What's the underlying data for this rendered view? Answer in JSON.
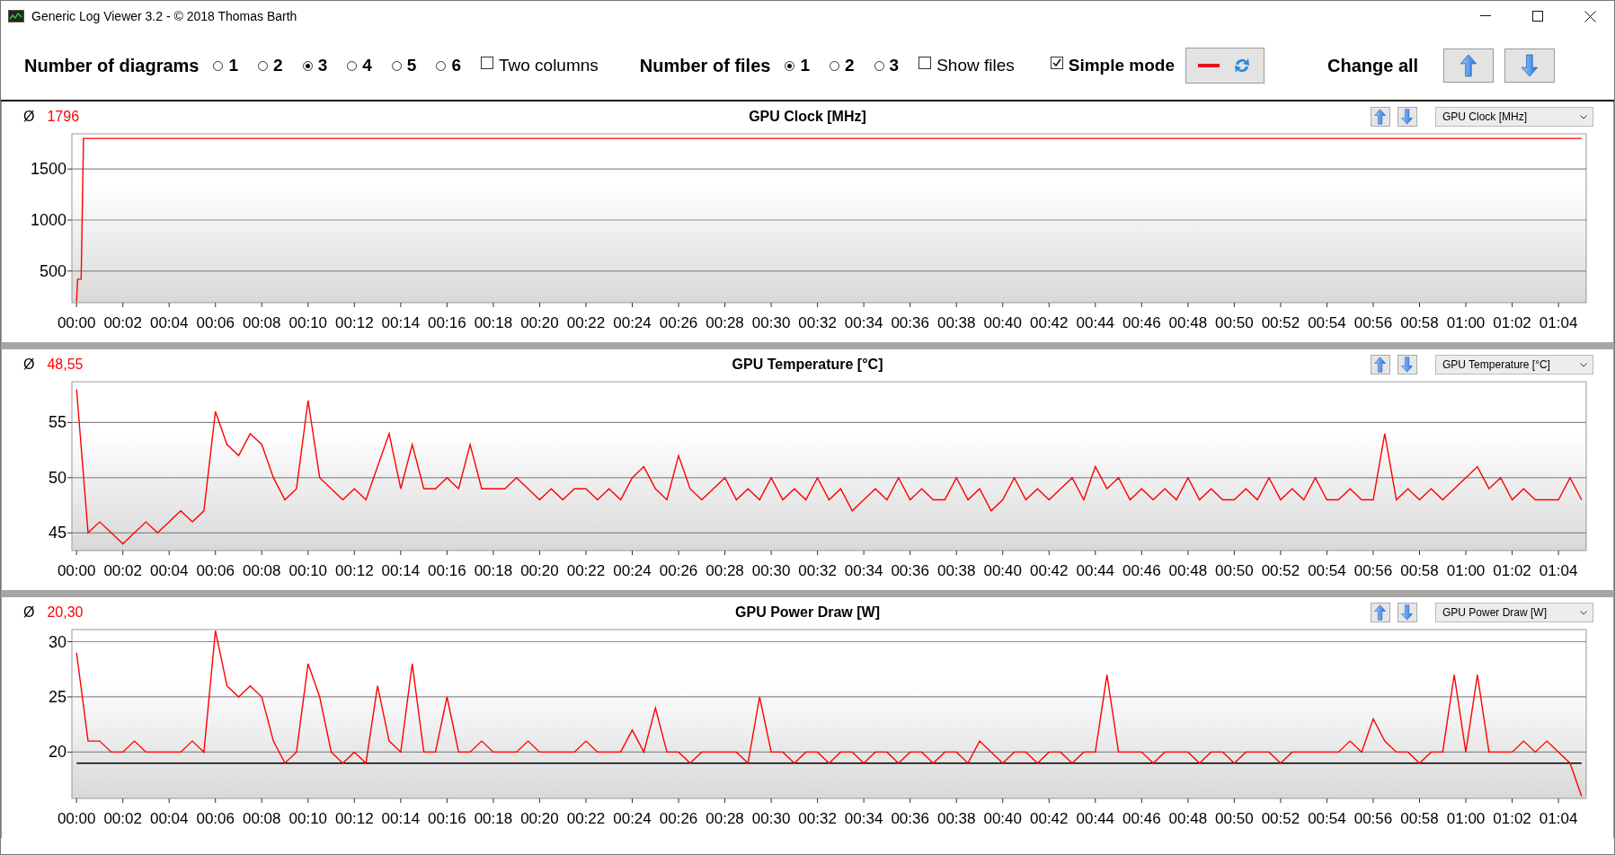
{
  "window": {
    "title": "Generic Log Viewer 3.2 - © 2018 Thomas Barth"
  },
  "toolbar": {
    "diagrams": {
      "label": "Number of diagrams",
      "options": [
        {
          "label": "1",
          "selected": false
        },
        {
          "label": "2",
          "selected": false
        },
        {
          "label": "3",
          "selected": true
        },
        {
          "label": "4",
          "selected": false
        },
        {
          "label": "5",
          "selected": false
        },
        {
          "label": "6",
          "selected": false
        }
      ]
    },
    "two_columns": {
      "label": "Two columns",
      "checked": false
    },
    "files": {
      "label": "Number of files",
      "options": [
        {
          "label": "1",
          "selected": true
        },
        {
          "label": "2",
          "selected": false
        },
        {
          "label": "3",
          "selected": false
        }
      ]
    },
    "show_files": {
      "label": "Show files",
      "checked": false
    },
    "simple_mode": {
      "label": "Simple mode",
      "checked": true
    },
    "change_all": {
      "label": "Change all"
    }
  },
  "diagrams": [
    {
      "average_symbol": "Ø",
      "average": "1796",
      "title": "GPU Clock [MHz]",
      "chart_data": {
        "type": "line",
        "x": [
          0,
          0.05,
          0.2,
          0.3,
          65
        ],
        "series": [
          {
            "name": "GPU Clock [MHz]",
            "color": "#ff0000",
            "values": [
              200,
              420,
              420,
              1800,
              1800
            ]
          }
        ],
        "grid": true,
        "xlim": [
          -0.2,
          65.2
        ],
        "ylim": [
          190,
          1845
        ],
        "yticks": [
          500,
          1000,
          1500
        ],
        "xticks": [
          {
            "value": 0,
            "label": "00:00"
          },
          {
            "value": 2,
            "label": "00:02"
          },
          {
            "value": 4,
            "label": "00:04"
          },
          {
            "value": 6,
            "label": "00:06"
          },
          {
            "value": 8,
            "label": "00:08"
          },
          {
            "value": 10,
            "label": "00:10"
          },
          {
            "value": 12,
            "label": "00:12"
          },
          {
            "value": 14,
            "label": "00:14"
          },
          {
            "value": 16,
            "label": "00:16"
          },
          {
            "value": 18,
            "label": "00:18"
          },
          {
            "value": 20,
            "label": "00:20"
          },
          {
            "value": 22,
            "label": "00:22"
          },
          {
            "value": 24,
            "label": "00:24"
          },
          {
            "value": 26,
            "label": "00:26"
          },
          {
            "value": 28,
            "label": "00:28"
          },
          {
            "value": 30,
            "label": "00:30"
          },
          {
            "value": 32,
            "label": "00:32"
          },
          {
            "value": 34,
            "label": "00:34"
          },
          {
            "value": 36,
            "label": "00:36"
          },
          {
            "value": 38,
            "label": "00:38"
          },
          {
            "value": 40,
            "label": "00:40"
          },
          {
            "value": 42,
            "label": "00:42"
          },
          {
            "value": 44,
            "label": "00:44"
          },
          {
            "value": 46,
            "label": "00:46"
          },
          {
            "value": 48,
            "label": "00:48"
          },
          {
            "value": 50,
            "label": "00:50"
          },
          {
            "value": 52,
            "label": "00:52"
          },
          {
            "value": 54,
            "label": "00:54"
          },
          {
            "value": 56,
            "label": "00:56"
          },
          {
            "value": 58,
            "label": "00:58"
          },
          {
            "value": 60,
            "label": "01:00"
          },
          {
            "value": 62,
            "label": "01:02"
          },
          {
            "value": 64,
            "label": "01:04"
          }
        ]
      }
    },
    {
      "average_symbol": "Ø",
      "average": "48,55",
      "title": "GPU Temperature [°C]",
      "chart_data": {
        "type": "line",
        "x": [
          0,
          0.5,
          1,
          1.5,
          2,
          2.5,
          3,
          3.5,
          4,
          4.5,
          5,
          5.5,
          6,
          6.5,
          7,
          7.5,
          8,
          8.5,
          9,
          9.5,
          10,
          10.5,
          11,
          11.5,
          12,
          12.5,
          13,
          13.5,
          14,
          14.5,
          15,
          15.5,
          16,
          16.5,
          17,
          17.5,
          18,
          18.5,
          19,
          19.5,
          20,
          20.5,
          21,
          21.5,
          22,
          22.5,
          23,
          23.5,
          24,
          24.5,
          25,
          25.5,
          26,
          26.5,
          27,
          27.5,
          28,
          28.5,
          29,
          29.5,
          30,
          30.5,
          31,
          31.5,
          32,
          32.5,
          33,
          33.5,
          34,
          34.5,
          35,
          35.5,
          36,
          36.5,
          37,
          37.5,
          38,
          38.5,
          39,
          39.5,
          40,
          40.5,
          41,
          41.5,
          42,
          42.5,
          43,
          43.5,
          44,
          44.5,
          45,
          45.5,
          46,
          46.5,
          47,
          47.5,
          48,
          48.5,
          49,
          49.5,
          50,
          50.5,
          51,
          51.5,
          52,
          52.5,
          53,
          53.5,
          54,
          54.5,
          55,
          55.5,
          56,
          56.5,
          57,
          57.5,
          58,
          58.5,
          59,
          59.5,
          60,
          60.5,
          61,
          61.5,
          62,
          62.5,
          63,
          63.5,
          64,
          64.5,
          65
        ],
        "grid": true,
        "series": [
          {
            "name": "GPU Temperature [°C]",
            "color": "#ff0000",
            "values": [
              58,
              45,
              46,
              45,
              44,
              45,
              46,
              45,
              46,
              47,
              46,
              47,
              56,
              53,
              52,
              54,
              53,
              50,
              48,
              49,
              57,
              50,
              49,
              48,
              49,
              48,
              51,
              54,
              49,
              53,
              49,
              49,
              50,
              49,
              53,
              49,
              49,
              49,
              50,
              49,
              48,
              49,
              48,
              49,
              49,
              48,
              49,
              48,
              50,
              51,
              49,
              48,
              52,
              49,
              48,
              49,
              50,
              48,
              49,
              48,
              50,
              48,
              49,
              48,
              50,
              48,
              49,
              47,
              48,
              49,
              48,
              50,
              48,
              49,
              48,
              48,
              50,
              48,
              49,
              47,
              48,
              50,
              48,
              49,
              48,
              49,
              50,
              48,
              51,
              49,
              50,
              48,
              49,
              48,
              49,
              48,
              50,
              48,
              49,
              48,
              48,
              49,
              48,
              50,
              48,
              49,
              48,
              50,
              48,
              48,
              49,
              48,
              48,
              54,
              48,
              49,
              48,
              49,
              48,
              49,
              50,
              51,
              49,
              50,
              48,
              49,
              48,
              48,
              48,
              50,
              48
            ]
          }
        ],
        "xlim": [
          -0.2,
          65.2
        ],
        "ylim": [
          43.4,
          58.7
        ],
        "yticks": [
          45,
          50,
          55
        ],
        "xticks": [
          {
            "value": 0,
            "label": "00:00"
          },
          {
            "value": 2,
            "label": "00:02"
          },
          {
            "value": 4,
            "label": "00:04"
          },
          {
            "value": 6,
            "label": "00:06"
          },
          {
            "value": 8,
            "label": "00:08"
          },
          {
            "value": 10,
            "label": "00:10"
          },
          {
            "value": 12,
            "label": "00:12"
          },
          {
            "value": 14,
            "label": "00:14"
          },
          {
            "value": 16,
            "label": "00:16"
          },
          {
            "value": 18,
            "label": "00:18"
          },
          {
            "value": 20,
            "label": "00:20"
          },
          {
            "value": 22,
            "label": "00:22"
          },
          {
            "value": 24,
            "label": "00:24"
          },
          {
            "value": 26,
            "label": "00:26"
          },
          {
            "value": 28,
            "label": "00:28"
          },
          {
            "value": 30,
            "label": "00:30"
          },
          {
            "value": 32,
            "label": "00:32"
          },
          {
            "value": 34,
            "label": "00:34"
          },
          {
            "value": 36,
            "label": "00:36"
          },
          {
            "value": 38,
            "label": "00:38"
          },
          {
            "value": 40,
            "label": "00:40"
          },
          {
            "value": 42,
            "label": "00:42"
          },
          {
            "value": 44,
            "label": "00:44"
          },
          {
            "value": 46,
            "label": "00:46"
          },
          {
            "value": 48,
            "label": "00:48"
          },
          {
            "value": 50,
            "label": "00:50"
          },
          {
            "value": 52,
            "label": "00:52"
          },
          {
            "value": 54,
            "label": "00:54"
          },
          {
            "value": 56,
            "label": "00:56"
          },
          {
            "value": 58,
            "label": "00:58"
          },
          {
            "value": 60,
            "label": "01:00"
          },
          {
            "value": 62,
            "label": "01:02"
          },
          {
            "value": 64,
            "label": "01:04"
          }
        ]
      }
    },
    {
      "average_symbol": "Ø",
      "average": "20,30",
      "title": "GPU Power Draw [W]",
      "chart_data": {
        "type": "line",
        "x": [
          0,
          0.5,
          1,
          1.5,
          2,
          2.5,
          3,
          3.5,
          4,
          4.5,
          5,
          5.5,
          6,
          6.5,
          7,
          7.5,
          8,
          8.5,
          9,
          9.5,
          10,
          10.5,
          11,
          11.5,
          12,
          12.5,
          13,
          13.5,
          14,
          14.5,
          15,
          15.5,
          16,
          16.5,
          17,
          17.5,
          18,
          18.5,
          19,
          19.5,
          20,
          20.5,
          21,
          21.5,
          22,
          22.5,
          23,
          23.5,
          24,
          24.5,
          25,
          25.5,
          26,
          26.5,
          27,
          27.5,
          28,
          28.5,
          29,
          29.5,
          30,
          30.5,
          31,
          31.5,
          32,
          32.5,
          33,
          33.5,
          34,
          34.5,
          35,
          35.5,
          36,
          36.5,
          37,
          37.5,
          38,
          38.5,
          39,
          39.5,
          40,
          40.5,
          41,
          41.5,
          42,
          42.5,
          43,
          43.5,
          44,
          44.5,
          45,
          45.5,
          46,
          46.5,
          47,
          47.5,
          48,
          48.5,
          49,
          49.5,
          50,
          50.5,
          51,
          51.5,
          52,
          52.5,
          53,
          53.5,
          54,
          54.5,
          55,
          55.5,
          56,
          56.5,
          57,
          57.5,
          58,
          58.5,
          59,
          59.5,
          60,
          60.5,
          61,
          61.5,
          62,
          62.5,
          63,
          63.5,
          64,
          64.5,
          65
        ],
        "series": [
          {
            "color": "#000000",
            "values": [
              19,
              19,
              19,
              19,
              19,
              19,
              19,
              19,
              19,
              19,
              19,
              19,
              19,
              19,
              19,
              19,
              19,
              19,
              19,
              19,
              19,
              19,
              19,
              19,
              19,
              19,
              19,
              19,
              19,
              19,
              19,
              19,
              19,
              19,
              19,
              19,
              19,
              19,
              19,
              19,
              19,
              19,
              19,
              19,
              19,
              19,
              19,
              19,
              19,
              19,
              19,
              19,
              19,
              19,
              19,
              19,
              19,
              19,
              19,
              19,
              19,
              19,
              19,
              19,
              19,
              19,
              19,
              19,
              19,
              19,
              19,
              19,
              19,
              19,
              19,
              19,
              19,
              19,
              19,
              19,
              19,
              19,
              19,
              19,
              19,
              19,
              19,
              19,
              19,
              19,
              19,
              19,
              19,
              19,
              19,
              19,
              19,
              19,
              19,
              19,
              19,
              19,
              19,
              19,
              19,
              19,
              19,
              19,
              19,
              19,
              19,
              19,
              19,
              19,
              19,
              19,
              19,
              19,
              19,
              19,
              19,
              19,
              19,
              19,
              19,
              19,
              19,
              19,
              19,
              19,
              19
            ]
          },
          {
            "name": "GPU Power Draw [W]",
            "color": "#ff0000",
            "values": [
              29,
              21,
              21,
              20,
              20,
              21,
              20,
              20,
              20,
              20,
              21,
              20,
              31,
              26,
              25,
              26,
              25,
              21,
              19,
              20,
              28,
              25,
              20,
              19,
              20,
              19,
              26,
              21,
              20,
              28,
              20,
              20,
              25,
              20,
              20,
              21,
              20,
              20,
              20,
              21,
              20,
              20,
              20,
              20,
              21,
              20,
              20,
              20,
              22,
              20,
              24,
              20,
              20,
              19,
              20,
              20,
              20,
              20,
              19,
              25,
              20,
              20,
              19,
              20,
              20,
              19,
              20,
              20,
              19,
              20,
              20,
              19,
              20,
              20,
              19,
              20,
              20,
              19,
              21,
              20,
              19,
              20,
              20,
              19,
              20,
              20,
              19,
              20,
              20,
              27,
              20,
              20,
              20,
              19,
              20,
              20,
              20,
              19,
              20,
              20,
              19,
              20,
              20,
              20,
              19,
              20,
              20,
              20,
              20,
              20,
              21,
              20,
              23,
              21,
              20,
              20,
              19,
              20,
              20,
              27,
              20,
              27,
              20,
              20,
              20,
              21,
              20,
              21,
              20,
              19,
              16
            ]
          }
        ],
        "grid": true,
        "xlim": [
          -0.2,
          65.2
        ],
        "ylim": [
          15.8,
          31.1
        ],
        "yticks": [
          20,
          25,
          30
        ],
        "xticks": [
          {
            "value": 0,
            "label": "00:00"
          },
          {
            "value": 2,
            "label": "00:02"
          },
          {
            "value": 4,
            "label": "00:04"
          },
          {
            "value": 6,
            "label": "00:06"
          },
          {
            "value": 8,
            "label": "00:08"
          },
          {
            "value": 10,
            "label": "00:10"
          },
          {
            "value": 12,
            "label": "00:12"
          },
          {
            "value": 14,
            "label": "00:14"
          },
          {
            "value": 16,
            "label": "00:16"
          },
          {
            "value": 18,
            "label": "00:18"
          },
          {
            "value": 20,
            "label": "00:20"
          },
          {
            "value": 22,
            "label": "00:22"
          },
          {
            "value": 24,
            "label": "00:24"
          },
          {
            "value": 26,
            "label": "00:26"
          },
          {
            "value": 28,
            "label": "00:28"
          },
          {
            "value": 30,
            "label": "00:30"
          },
          {
            "value": 32,
            "label": "00:32"
          },
          {
            "value": 34,
            "label": "00:34"
          },
          {
            "value": 36,
            "label": "00:36"
          },
          {
            "value": 38,
            "label": "00:38"
          },
          {
            "value": 40,
            "label": "00:40"
          },
          {
            "value": 42,
            "label": "00:42"
          },
          {
            "value": 44,
            "label": "00:44"
          },
          {
            "value": 46,
            "label": "00:46"
          },
          {
            "value": 48,
            "label": "00:48"
          },
          {
            "value": 50,
            "label": "00:50"
          },
          {
            "value": 52,
            "label": "00:52"
          },
          {
            "value": 54,
            "label": "00:54"
          },
          {
            "value": 56,
            "label": "00:56"
          },
          {
            "value": 58,
            "label": "00:58"
          },
          {
            "value": 60,
            "label": "01:00"
          },
          {
            "value": 62,
            "label": "01:02"
          },
          {
            "value": 64,
            "label": "01:04"
          }
        ]
      }
    }
  ]
}
